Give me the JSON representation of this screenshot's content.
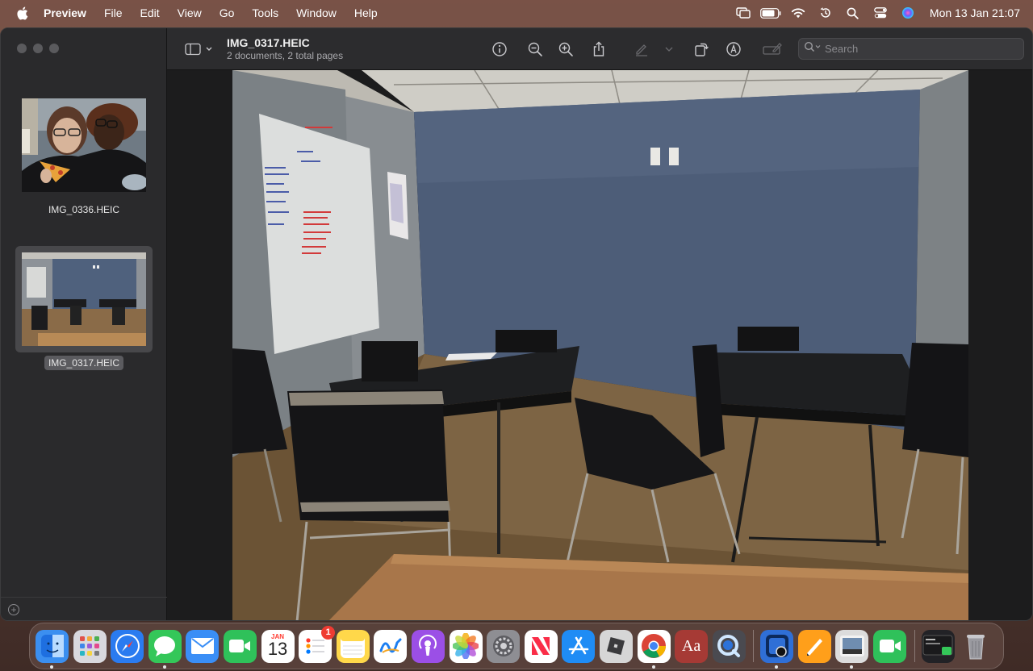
{
  "menubar": {
    "app_name": "Preview",
    "menus": [
      "File",
      "Edit",
      "View",
      "Go",
      "Tools",
      "Window",
      "Help"
    ],
    "clock": "Mon 13 Jan  21:07"
  },
  "window": {
    "title": "IMG_0317.HEIC",
    "subtitle": "2 documents, 2 total pages",
    "search_placeholder": "Search"
  },
  "sidebar": {
    "items": [
      {
        "filename": "IMG_0336.HEIC",
        "selected": false
      },
      {
        "filename": "IMG_0317.HEIC",
        "selected": true
      }
    ]
  },
  "dock": {
    "apps": [
      {
        "name": "finder-icon",
        "color": "#3b8ff0",
        "running": true
      },
      {
        "name": "launchpad-icon",
        "color": "#d9d9de",
        "running": false
      },
      {
        "name": "safari-icon",
        "color": "#2a7bf0",
        "running": false
      },
      {
        "name": "messages-icon",
        "color": "#34c759",
        "running": true
      },
      {
        "name": "mail-icon",
        "color": "#3a8ef6",
        "running": false
      },
      {
        "name": "facetime-icon",
        "color": "#2fc15a",
        "running": false
      },
      {
        "name": "calendar-icon",
        "color": "#ffffff",
        "running": false,
        "month": "JAN",
        "day": "13"
      },
      {
        "name": "reminders-icon",
        "color": "#ffffff",
        "running": false,
        "badge": "1"
      },
      {
        "name": "notes-icon",
        "color": "#ffd84a",
        "running": false
      },
      {
        "name": "freeform-icon",
        "color": "#ffffff",
        "running": false
      },
      {
        "name": "podcasts-icon",
        "color": "#9b4fe6",
        "running": false
      },
      {
        "name": "photos-icon",
        "color": "#ffffff",
        "running": false
      },
      {
        "name": "system-settings-icon",
        "color": "#8e8e93",
        "running": false
      },
      {
        "name": "news-icon",
        "color": "#ffffff",
        "running": false
      },
      {
        "name": "app-store-icon",
        "color": "#1f8cf5",
        "running": false
      },
      {
        "name": "roblox-icon",
        "color": "#d6d6d6",
        "running": false
      },
      {
        "name": "chrome-icon",
        "color": "#ffffff",
        "running": true
      },
      {
        "name": "dictionary-icon",
        "color": "#a63a35",
        "running": false,
        "glyph": "Aa"
      },
      {
        "name": "quicktime-icon",
        "color": "#4a4a50",
        "running": false
      },
      {
        "name": "preview-icon",
        "color": "#2f6fd6",
        "running": true
      },
      {
        "name": "pages-icon",
        "color": "#ff9f1a",
        "running": false
      },
      {
        "name": "preview-document-icon",
        "color": "#dcdcdc",
        "running": true
      },
      {
        "name": "facetime-mini-icon",
        "color": "#2fc15a",
        "running": false
      },
      {
        "name": "screen-preview-icon",
        "color": "#222226",
        "running": false
      },
      {
        "name": "trash-icon",
        "color": "#9a9aa0",
        "running": false
      }
    ]
  }
}
